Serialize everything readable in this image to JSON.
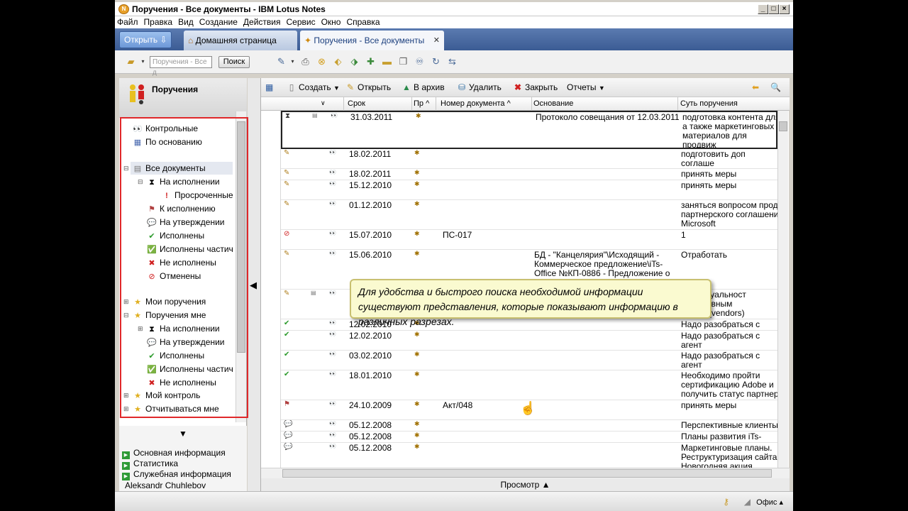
{
  "window": {
    "title": "Поручения - Все документы - IBM Lotus Notes"
  },
  "menu": [
    "Файл",
    "Правка",
    "Вид",
    "Создание",
    "Действия",
    "Сервис",
    "Окно",
    "Справка"
  ],
  "tabs": {
    "open": "Открыть",
    "home": "Домашняя страница",
    "current": "Поручения - Все документы"
  },
  "search": {
    "placeholder": "Поручения - Все д",
    "button": "Поиск"
  },
  "nav": {
    "title": "Поручения",
    "items": [
      {
        "label": "Контрольные",
        "icon": "eyes-icon"
      },
      {
        "label": "По основанию",
        "icon": "grid-icon"
      },
      {
        "label": "Все документы",
        "icon": "documents-icon"
      },
      {
        "label": "На исполнении",
        "icon": "hourglass-icon"
      },
      {
        "label": "Просроченные",
        "icon": "exclamation-icon"
      },
      {
        "label": "К исполнению",
        "icon": "flag-icon"
      },
      {
        "label": "На утверждении",
        "icon": "chat-icon"
      },
      {
        "label": "Исполнены",
        "icon": "check-icon"
      },
      {
        "label": "Исполнены частич",
        "icon": "partial-check-icon"
      },
      {
        "label": "Не исполнены",
        "icon": "x-icon"
      },
      {
        "label": "Отменены",
        "icon": "cancel-icon"
      },
      {
        "label": "Мои поручения",
        "icon": "star-icon"
      },
      {
        "label": "Поручения мне",
        "icon": "star-icon"
      },
      {
        "label": "На исполнении",
        "icon": "hourglass-icon"
      },
      {
        "label": "На утверждении",
        "icon": "chat-icon"
      },
      {
        "label": "Исполнены",
        "icon": "check-icon"
      },
      {
        "label": "Исполнены частич",
        "icon": "partial-check-icon"
      },
      {
        "label": "Не исполнены",
        "icon": "x-icon"
      },
      {
        "label": "Мой контроль",
        "icon": "star-icon"
      },
      {
        "label": "Отчитываться мне",
        "icon": "star-icon"
      }
    ],
    "footer": [
      "Основная информация",
      "Статистика",
      "Служебная информация"
    ],
    "user": "Aleksandr Chuhlebov"
  },
  "actions": {
    "create": "Создать",
    "open": "Открыть",
    "archive": "В архив",
    "delete": "Удалить",
    "close": "Закрыть",
    "reports": "Отчеты"
  },
  "columns": {
    "deadline": "Срок",
    "priority": "Пр",
    "docnum": "Номер документа",
    "basis": "Основание",
    "essence": "Суть поручения"
  },
  "rows": [
    {
      "date": "31.03.2011",
      "num": "",
      "basis": "Протоколо совещания от 12.03.2011",
      "essence": "подготовка контента для\nа также маркетинговых\nматериалов для продвиж\niTs-ASpam",
      "status": "hourglass-icon",
      "selected": true
    },
    {
      "date": "18.02.2011",
      "num": "",
      "basis": "",
      "essence": "подготовить доп соглаше",
      "status": "pencil-icon"
    },
    {
      "date": "18.02.2011",
      "num": "",
      "basis": "",
      "essence": "принять меры",
      "status": "pencil-icon"
    },
    {
      "date": "15.12.2010",
      "num": "",
      "basis": "",
      "essence": "принять меры",
      "status": "pencil-icon"
    },
    {
      "date": "01.12.2010",
      "num": "",
      "basis": "",
      "essence": "заняться вопросом прод\nпартнерского соглашени\nMicrosoft",
      "status": "pencil-icon"
    },
    {
      "date": "15.07.2010",
      "num": "ПС-017",
      "basis": "",
      "essence": "1",
      "status": "cancel-icon"
    },
    {
      "date": "15.06.2010",
      "num": "",
      "basis": "БД - \"Канцелярия\"\\Исходящий -\nКоммерческое предложение\\iTs-\nOffice №КП-0886 - Предложение о",
      "essence": "Отработать",
      "status": "pencil-icon"
    },
    {
      "date": "",
      "num": "",
      "basis": "",
      "essence": "жка актуальност\nпо основным\nм (Z:\\3_vendors)",
      "status": "pencil-icon"
    },
    {
      "date": "12.02.2010",
      "num": "",
      "basis": "",
      "essence": "Надо разобраться с агент",
      "status": "check-icon"
    },
    {
      "date": "12.02.2010",
      "num": "",
      "basis": "",
      "essence": "Надо разобраться с агент\nдеве",
      "status": "check-icon"
    },
    {
      "date": "03.02.2010",
      "num": "",
      "basis": "",
      "essence": "Надо разобраться с агент\nИнформация в теле.",
      "status": "check-icon"
    },
    {
      "date": "18.01.2010",
      "num": "",
      "basis": "",
      "essence": "Необходимо пройти\nсертификацию Adobe и\nполучить статус партнер",
      "status": "check-icon"
    },
    {
      "date": "24.10.2009",
      "num": "Акт/048",
      "basis": "",
      "essence": "принять меры",
      "status": "flag-icon"
    },
    {
      "date": "05.12.2008",
      "num": "",
      "basis": "",
      "essence": "Перспективные клиенты",
      "status": "chat-icon"
    },
    {
      "date": "05.12.2008",
      "num": "",
      "basis": "",
      "essence": "Планы развития iTs-Office",
      "status": "chat-icon"
    },
    {
      "date": "05.12.2008",
      "num": "",
      "basis": "",
      "essence": "Маркетинговые планы.\nРеструктуризация сайта.\nНовогодняя акция.",
      "status": "chat-icon"
    }
  ],
  "tooltip": "Для удобства и быстрого поиска необходимой информации существуют представления, которые показывают информацию в различных разрезах.",
  "preview": "Просмотр",
  "status": {
    "location": "Офис"
  },
  "colors": {
    "accent": "#3b5c94",
    "highlight": "#e0282a",
    "tooltip": "#fafad0"
  }
}
